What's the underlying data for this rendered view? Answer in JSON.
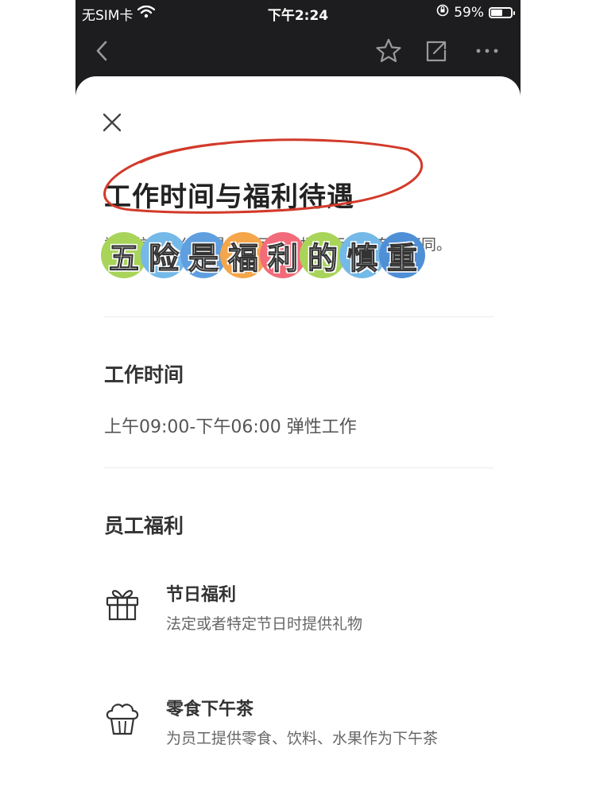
{
  "status_bar": {
    "carrier": "无SIM卡",
    "time": "下午2:24",
    "battery_text": "59%",
    "battery_level": 0.59
  },
  "nav": {
    "back_icon": "chevron-left-icon",
    "favorite_icon": "star-outline-icon",
    "share_icon": "share-icon",
    "more_icon": "more-horizontal-icon"
  },
  "sheet": {
    "title": "工作时间与福利待遇",
    "subtitle": "福利信息由公司提供，可能根据实际岗位有所不同。",
    "sticker_chars": [
      "五",
      "险",
      "是",
      "福",
      "利",
      "的",
      "慎",
      "重"
    ],
    "sticker_colors": [
      "#a8d45a",
      "#74b9e8",
      "#5f9fe0",
      "#f5a54a",
      "#f26b7a",
      "#a8d45a",
      "#74b9e8",
      "#4f8fd6"
    ],
    "annotation_color": "#d23a2a"
  },
  "work_time": {
    "heading": "工作时间",
    "hours": "上午09:00-下午06:00 弹性工作"
  },
  "benefits": {
    "heading": "员工福利",
    "items": [
      {
        "icon": "gift-icon",
        "title": "节日福利",
        "desc": "法定或者特定节日时提供礼物"
      },
      {
        "icon": "cupcake-icon",
        "title": "零食下午茶",
        "desc": "为员工提供零食、饮料、水果作为下午茶"
      }
    ]
  }
}
